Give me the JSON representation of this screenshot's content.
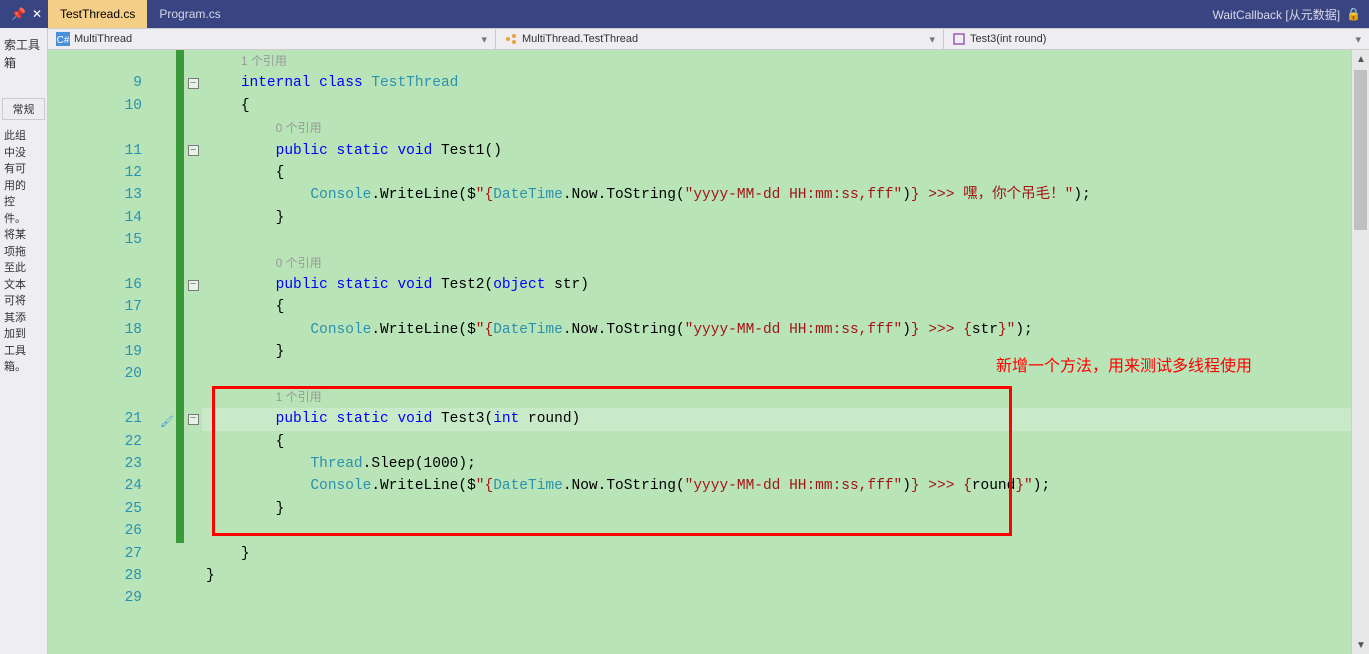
{
  "topbar": {
    "pin_char": "📌",
    "close_char": "✕",
    "tabs": [
      {
        "label": "TestThread.cs",
        "active": true
      },
      {
        "label": "Program.cs",
        "active": false
      }
    ],
    "status": "WaitCallback [从元数据]",
    "lock_glyph": "🔒"
  },
  "breadcrumb": {
    "namespace": "MultiThread",
    "class": "MultiThread.TestThread",
    "member": "Test3(int round)"
  },
  "left_panel": {
    "title1": "索工具箱",
    "box1": "常规",
    "body": "此组\n中没\n有可\n用的\n控\n件。\n将某\n项拖\n至此\n文本\n可将\n其添\n加到\n工具\n箱。"
  },
  "annotation_text": "新增一个方法，用来测试多线程使用",
  "code": {
    "refcount1": "1 个引用",
    "refcount0_1": "0 个引用",
    "refcount0_2": "0 个引用",
    "refcount1_b": "1 个引用",
    "lines": {
      "l9": {
        "num": "9",
        "fold": "-"
      },
      "l10": {
        "num": "10"
      },
      "l11": {
        "num": "11",
        "fold": "-"
      },
      "l12": {
        "num": "12"
      },
      "l13": {
        "num": "13"
      },
      "l14": {
        "num": "14"
      },
      "l15": {
        "num": "15"
      },
      "l16": {
        "num": "16",
        "fold": "-"
      },
      "l17": {
        "num": "17"
      },
      "l18": {
        "num": "18"
      },
      "l19": {
        "num": "19"
      },
      "l20": {
        "num": "20"
      },
      "l21": {
        "num": "21",
        "fold": "-"
      },
      "l22": {
        "num": "22"
      },
      "l23": {
        "num": "23"
      },
      "l24": {
        "num": "24"
      },
      "l25": {
        "num": "25"
      },
      "l26": {
        "num": "26"
      },
      "l27": {
        "num": "27"
      },
      "l28": {
        "num": "28"
      },
      "l29": {
        "num": "29"
      }
    },
    "tokens": {
      "internal": "internal",
      "class": "class",
      "TestThread": "TestThread",
      "public": "public",
      "static": "static",
      "void": "void",
      "Test1": "Test1",
      "Test2": "Test2",
      "Test3": "Test3",
      "object": "object",
      "int": "int",
      "str": "str",
      "round": "round",
      "Console": "Console",
      "WriteLine": "WriteLine",
      "DateTime": "DateTime",
      "Now": "Now",
      "ToString": "ToString",
      "Thread": "Thread",
      "Sleep": "Sleep",
      "sleeparg": "(1000);",
      "dollar": "($",
      "fmt1": "\"{",
      "fmt2": "\"yyyy-MM-dd HH:mm:ss,fff\"",
      "tail1": "} >>> 嘿，你个吊毛！\"",
      "tail2": "} >>> {",
      "tail2end": "}\"",
      "tail3": "} >>> {",
      "tail3end": "}\"",
      "paren_close_semi": ");",
      "open_brace": "{",
      "close_brace": "}",
      "empty_parens": "()",
      "open_paren": "(",
      "close_paren": ")",
      "dot": ".",
      "space": " "
    }
  }
}
